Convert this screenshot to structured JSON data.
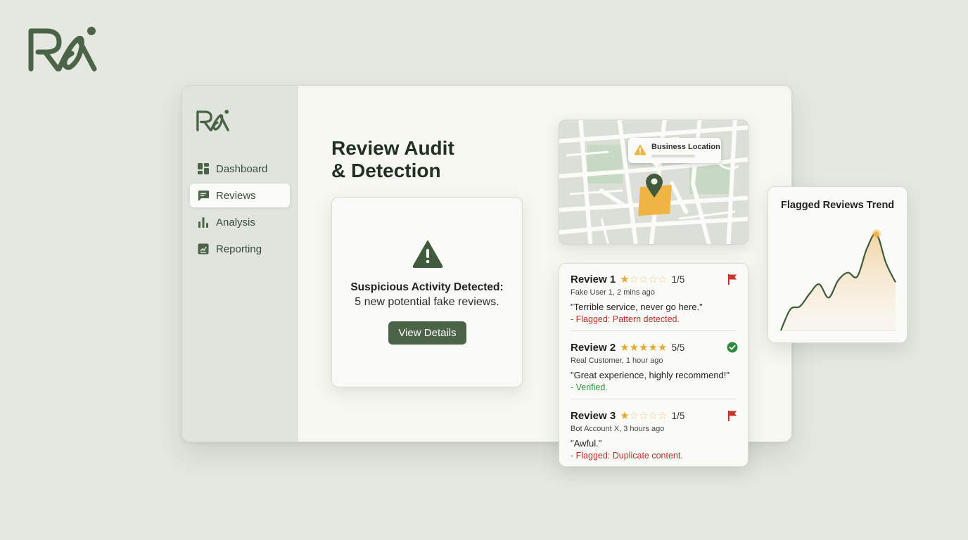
{
  "brand": {
    "logo_text": "Rai"
  },
  "sidebar": {
    "items": [
      {
        "label": "Dashboard",
        "icon": "dashboard-grid-icon",
        "active": false
      },
      {
        "label": "Reviews",
        "icon": "chat-bubble-icon",
        "active": true
      },
      {
        "label": "Analysis",
        "icon": "bar-chart-icon",
        "active": false
      },
      {
        "label": "Reporting",
        "icon": "report-document-icon",
        "active": false
      }
    ]
  },
  "page": {
    "title_line1": "Review Audit",
    "title_line2": "& Detection"
  },
  "alert": {
    "icon": "warning-triangle-icon",
    "title": "Suspicious Activity Detected:",
    "message": "5 new potential fake reviews.",
    "button_label": "View Details"
  },
  "map": {
    "tooltip_label": "Business Location",
    "pin_icon": "map-pin-icon"
  },
  "reviews": [
    {
      "title": "Review 1",
      "stars": 1,
      "rating": "1/5",
      "meta": "Fake User 1, 2 mins ago",
      "quote": "\"Terrible service, never go here.\"",
      "status": "- Flagged: Pattern detected.",
      "status_type": "flagged",
      "icon": "red-flag-icon"
    },
    {
      "title": "Review 2",
      "stars": 5,
      "rating": "5/5",
      "meta": "Real Customer, 1 hour ago",
      "quote": "\"Great experience, highly recommend!\"",
      "status": "- Verified.",
      "status_type": "verified",
      "icon": "green-check-icon"
    },
    {
      "title": "Review 3",
      "stars": 1,
      "rating": "1/5",
      "meta": "Bot Account X, 3 hours ago",
      "quote": "\"Awful.\"",
      "status": "- Flagged: Duplicate content.",
      "status_type": "flagged",
      "icon": "red-flag-icon"
    }
  ],
  "trend": {
    "title": "Flagged Reviews Trend"
  },
  "colors": {
    "background": "#e5e8e1",
    "accent_green": "#4b6346",
    "star_gold": "#e3a82f",
    "flag_red": "#b3302a",
    "verified_green": "#2f8a3c"
  },
  "chart_data": {
    "type": "area",
    "title": "Flagged Reviews Trend",
    "xlabel": "",
    "ylabel": "",
    "x": [
      0,
      1,
      2,
      3,
      4,
      5,
      6,
      7,
      8,
      9,
      10,
      11,
      12
    ],
    "values": [
      0,
      0.22,
      0.25,
      0.38,
      0.48,
      0.34,
      0.52,
      0.6,
      0.56,
      0.85,
      1.0,
      0.7,
      0.5
    ],
    "ylim": [
      0,
      1.05
    ],
    "grid": false,
    "highlight_index": 10
  }
}
